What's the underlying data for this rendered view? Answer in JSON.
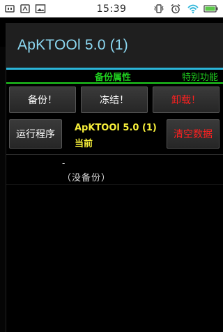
{
  "status_bar": {
    "time": "15:39",
    "left_icons": [
      "usb-icon",
      "usb-debug-icon",
      "image-icon"
    ],
    "right_icons": [
      "vibrate-icon",
      "alarm-icon",
      "wifi-icon",
      "battery-icon"
    ]
  },
  "dialog": {
    "title": "ApKTOOl 5.0 (1)",
    "tabs": [
      {
        "label": "备份属性"
      },
      {
        "label": "特别功能"
      }
    ],
    "buttons": {
      "backup": "备份！",
      "freeze": "冻结！",
      "uninstall": "卸载！",
      "run": "运行程序",
      "clear_data": "清空数据"
    },
    "app_name": "ApKTOOl 5.0 (1)",
    "app_state": "当前",
    "backup_dash": "-",
    "no_backup": "（没备份）"
  },
  "colors": {
    "accent_blue": "#2bb5d9",
    "tab_green": "#1fd01f",
    "app_yellow": "#f7ef3a",
    "danger_red": "#ff2020"
  }
}
